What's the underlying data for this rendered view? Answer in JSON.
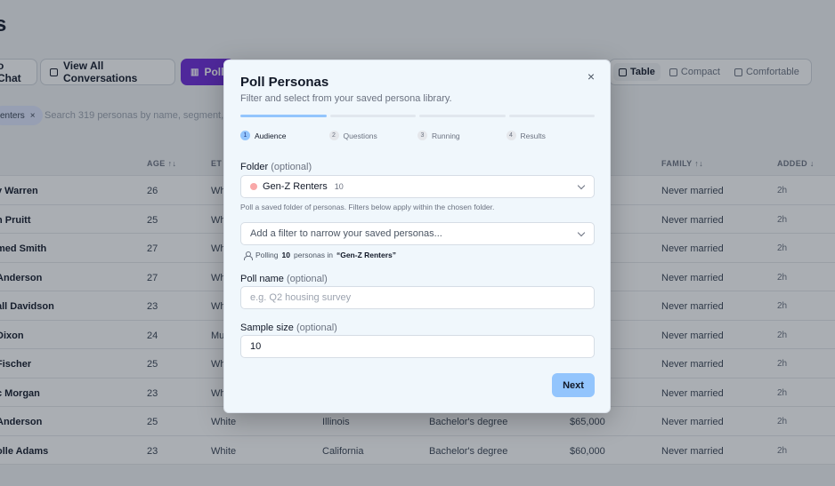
{
  "page": {
    "title": "s",
    "toolbar": {
      "chat_label": "o Chat",
      "conversations_label": "View All Conversations",
      "poll_label": "Poll",
      "views": [
        {
          "label": "Table",
          "active": true
        },
        {
          "label": "Compact",
          "active": false
        },
        {
          "label": "Comfortable",
          "active": false
        }
      ]
    },
    "filter": {
      "chip_label": "enters",
      "search_placeholder": "Search 319 personas by name, segment, or"
    },
    "table": {
      "headers": {
        "age": "AGE ↑↓",
        "eth": "ET",
        "family": "FAMILY ↑↓",
        "added": "ADDED ↓"
      },
      "rows": [
        {
          "name": "y Warren",
          "age": "26",
          "eth": "Wh",
          "state": "",
          "education": "",
          "income": "",
          "family": "Never married",
          "added": "2h"
        },
        {
          "name": "n Pruitt",
          "age": "25",
          "eth": "Wh",
          "state": "",
          "education": "",
          "income": "",
          "family": "Never married",
          "added": "2h"
        },
        {
          "name": "med Smith",
          "age": "27",
          "eth": "Wh",
          "state": "",
          "education": "",
          "income": "",
          "family": "Never married",
          "added": "2h"
        },
        {
          "name": "Anderson",
          "age": "27",
          "eth": "Wh",
          "state": "",
          "education": "",
          "income": "",
          "family": "Never married",
          "added": "2h"
        },
        {
          "name": "all Davidson",
          "age": "23",
          "eth": "Wh",
          "state": "",
          "education": "",
          "income": "",
          "family": "Never married",
          "added": "2h"
        },
        {
          "name": "Dixon",
          "age": "24",
          "eth": "Mu",
          "state": "",
          "education": "",
          "income": "",
          "family": "Never married",
          "added": "2h"
        },
        {
          "name": "Fischer",
          "age": "25",
          "eth": "Wh",
          "state": "",
          "education": "",
          "income": "",
          "family": "Never married",
          "added": "2h"
        },
        {
          "name": "c Morgan",
          "age": "23",
          "eth": "Wh",
          "state": "",
          "education": "",
          "income": "",
          "family": "Never married",
          "added": "2h"
        },
        {
          "name": "Anderson",
          "age": "25",
          "eth": "White",
          "state": "Illinois",
          "education": "Bachelor's degree",
          "income": "$65,000",
          "family": "Never married",
          "added": "2h"
        },
        {
          "name": "olle Adams",
          "age": "23",
          "eth": "White",
          "state": "California",
          "education": "Bachelor's degree",
          "income": "$60,000",
          "family": "Never married",
          "added": "2h"
        }
      ]
    }
  },
  "modal": {
    "title": "Poll Personas",
    "subtitle": "Filter and select from your saved persona library.",
    "progress_active_step": 1,
    "steps": [
      {
        "num": "1",
        "label": "Audience",
        "active": true
      },
      {
        "num": "2",
        "label": "Questions",
        "active": false
      },
      {
        "num": "3",
        "label": "Running",
        "active": false
      },
      {
        "num": "4",
        "label": "Results",
        "active": false
      }
    ],
    "folder": {
      "label": "Folder",
      "optional": "(optional)",
      "value": "Gen-Z Renters",
      "count": "10",
      "hint": "Poll a saved folder of personas. Filters below apply within the chosen folder."
    },
    "filter": {
      "placeholder": "Add a filter to narrow your saved personas..."
    },
    "polling_note": {
      "prefix": "Polling",
      "count": "10",
      "middle": "personas in",
      "folder": "“Gen-Z Renters”"
    },
    "poll_name": {
      "label": "Poll name",
      "optional": "(optional)",
      "placeholder": "e.g. Q2 housing survey"
    },
    "sample_size": {
      "label": "Sample size",
      "optional": "(optional)",
      "value": "10"
    },
    "next_label": "Next",
    "close_glyph": "×"
  },
  "colors": {
    "accent": "#93c5fd",
    "poll_button": "#6d28d9",
    "folder_dot": "#f9a8a8"
  }
}
